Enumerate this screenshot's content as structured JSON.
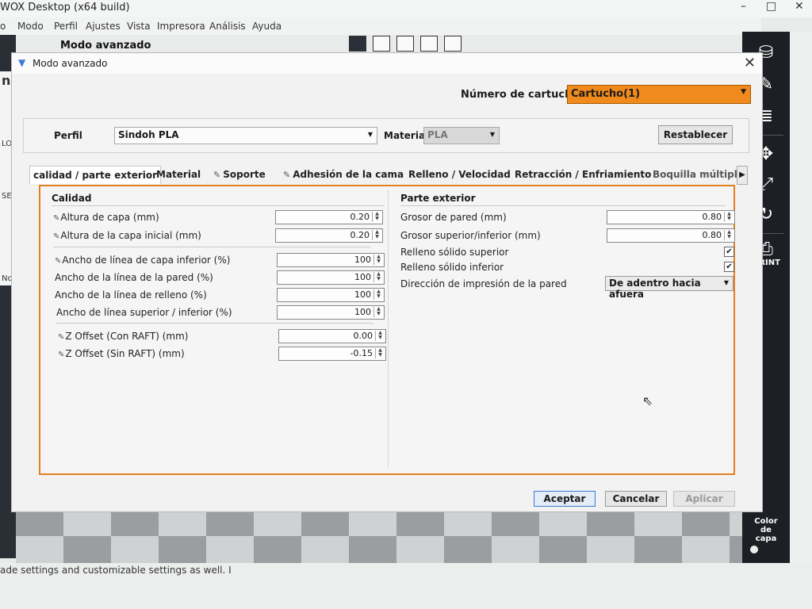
{
  "app": {
    "title": "WOX Desktop (x64 build)",
    "window_controls": [
      "–",
      "□",
      "✕"
    ],
    "menu": [
      "o",
      "Modo",
      "Perfil",
      "Ajustes",
      "Vista",
      "Impresora",
      "Análisis",
      "Ayuda"
    ],
    "mode_label": "Modo avanzado",
    "left_sidebar_texts": [
      "n",
      "LO",
      "SET",
      "No"
    ],
    "right_panel": {
      "print_label": "PRINT",
      "color_label": "Color de capa"
    },
    "bottom_text": "ade settings and customizable settings as well. I"
  },
  "dialog": {
    "title": "Modo avanzado",
    "cartridge": {
      "label": "Número de cartucho",
      "value": "Cartucho(1)"
    },
    "profile": {
      "label": "Perfil",
      "value": "Sindoh PLA"
    },
    "material": {
      "label": "Material",
      "value": "PLA"
    },
    "reset_button": "Restablecer",
    "tabs": [
      {
        "label": "calidad / parte exterior",
        "active": true
      },
      {
        "label": "Material"
      },
      {
        "label": "Soporte"
      },
      {
        "label": "Adhesión de la cama"
      },
      {
        "label": "Relleno / Velocidad"
      },
      {
        "label": "Retracción / Enfriamiento"
      },
      {
        "label": "Boquilla múltiple"
      }
    ],
    "quality": {
      "title": "Calidad",
      "rows": [
        {
          "label": "Altura de capa (mm)",
          "value": "0.20"
        },
        {
          "label": "Altura de la capa inicial (mm)",
          "value": "0.20"
        },
        {
          "label": "Ancho de línea de capa inferior (%)",
          "value": "100"
        },
        {
          "label": "Ancho de la línea de la pared (%)",
          "value": "100"
        },
        {
          "label": "Ancho de la línea de relleno (%)",
          "value": "100"
        },
        {
          "label": "Ancho de línea superior / inferior (%)",
          "value": "100"
        },
        {
          "label": "Z Offset (Con RAFT) (mm)",
          "value": "0.00"
        },
        {
          "label": "Z Offset (Sin RAFT) (mm)",
          "value": "-0.15"
        }
      ]
    },
    "exterior": {
      "title": "Parte exterior",
      "wall_thickness": {
        "label": "Grosor de pared (mm)",
        "value": "0.80"
      },
      "top_bottom_thickness": {
        "label": "Grosor superior/inferior (mm)",
        "value": "0.80"
      },
      "solid_top": {
        "label": "Relleno sólido superior",
        "checked": true
      },
      "solid_bottom": {
        "label": "Relleno sólido inferior",
        "checked": true
      },
      "wall_direction": {
        "label": "Dirección de impresión de la pared",
        "value": "De adentro hacia afuera"
      }
    },
    "buttons": {
      "accept": "Aceptar",
      "cancel": "Cancelar",
      "apply": "Aplicar"
    }
  }
}
